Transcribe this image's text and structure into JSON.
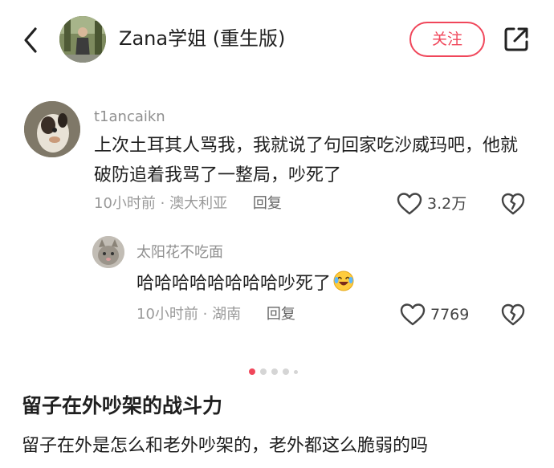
{
  "header": {
    "author_name": "Zana学姐 (重生版)",
    "follow_label": "关注",
    "back_icon": "chevron-left-icon",
    "share_icon": "share-external-icon",
    "accent_color": "#f0465a"
  },
  "comments": [
    {
      "username": "t1ancaikn",
      "text": "上次土耳其人骂我，我就说了句回家吃沙威玛吧，他就破防追着我骂了一整局，吵死了",
      "time": "10小时前",
      "location": "澳大利亚",
      "reply_label": "回复",
      "likes": "3.2万"
    },
    {
      "username": "太阳花不吃面",
      "text": "哈哈哈哈哈哈哈哈吵死了",
      "time": "10小时前",
      "location": "湖南",
      "reply_label": "回复",
      "likes": "7769"
    }
  ],
  "pager": {
    "active_index": 0,
    "count": 5
  },
  "post": {
    "title": "留子在外吵架的战斗力",
    "body": "留子在外是怎么和老外吵架的，老外都这么脆弱的吗"
  }
}
